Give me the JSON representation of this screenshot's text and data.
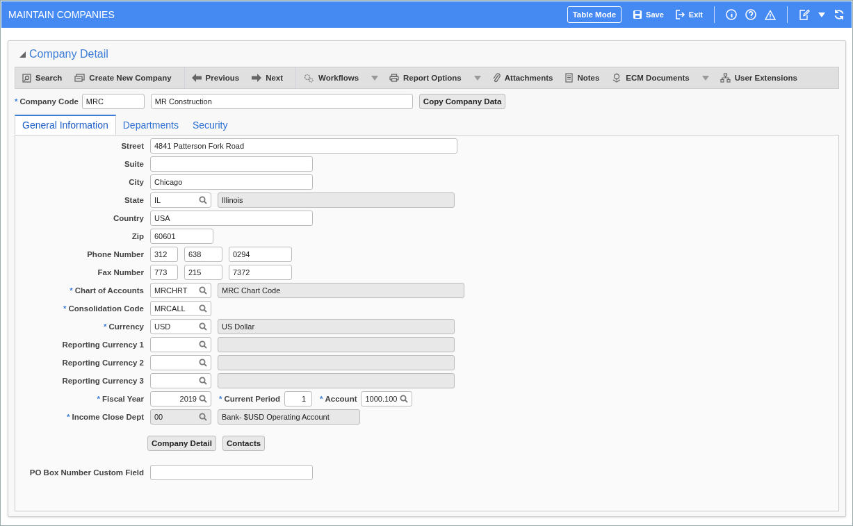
{
  "window": {
    "title": "MAINTAIN COMPANIES"
  },
  "header_actions": [
    {
      "kind": "outlined",
      "label": "Table Mode"
    },
    {
      "kind": "save",
      "label": "Save"
    },
    {
      "kind": "exit",
      "label": "Exit"
    }
  ],
  "panel": {
    "title": "Company Detail",
    "expanded": true
  },
  "toolbar": [
    {
      "label": "Search",
      "dropdown": false
    },
    {
      "label": "Create New Company",
      "dropdown": false
    },
    {
      "label": "Previous",
      "dropdown": false
    },
    {
      "label": "Next",
      "dropdown": false
    },
    {
      "label": "Workflows",
      "dropdown": true
    },
    {
      "label": "Report Options",
      "dropdown": true
    },
    {
      "label": "Attachments",
      "dropdown": false
    },
    {
      "label": "Notes",
      "dropdown": false
    },
    {
      "label": "ECM Documents",
      "dropdown": true
    },
    {
      "label": "User Extensions",
      "dropdown": false
    }
  ],
  "company": {
    "mark": "*",
    "label": "Company Code",
    "code": "MRC",
    "name": "MR Construction",
    "button": "Copy Company Data"
  },
  "tabs": [
    {
      "label": "General Information",
      "selected": true
    },
    {
      "label": "Departments",
      "selected": false
    },
    {
      "label": "Security",
      "selected": false
    }
  ],
  "form": [
    {
      "label": "Street",
      "fields": [
        {
          "kind": "text",
          "value": "4841 Patterson Fork Road",
          "disabled": false
        }
      ]
    },
    {
      "label": "Suite",
      "fields": [
        {
          "kind": "text",
          "disabled": false
        }
      ]
    },
    {
      "label": "City",
      "fields": [
        {
          "kind": "text",
          "value": "Chicago",
          "disabled": false
        }
      ]
    },
    {
      "label": "State",
      "fields": [
        {
          "kind": "lookup",
          "value": "IL",
          "disabled": false
        },
        {
          "kind": "display",
          "value": "Illinois",
          "disabled": true
        }
      ]
    },
    {
      "label": "Country",
      "fields": [
        {
          "kind": "text",
          "value": "USA",
          "disabled": false
        }
      ]
    },
    {
      "label": "Zip",
      "fields": [
        {
          "kind": "text",
          "value": "60601",
          "disabled": false
        }
      ]
    },
    {
      "label": "Phone Number",
      "fields": [
        {
          "kind": "text",
          "value": "312",
          "disabled": false
        },
        {
          "kind": "text",
          "value": "638",
          "disabled": false
        },
        {
          "kind": "text",
          "value": "0294",
          "disabled": false
        }
      ]
    },
    {
      "label": "Fax Number",
      "fields": [
        {
          "kind": "text",
          "value": "773",
          "disabled": false
        },
        {
          "kind": "text",
          "value": "215",
          "disabled": false
        },
        {
          "kind": "text",
          "value": "7372",
          "disabled": false
        }
      ]
    },
    {
      "mark": "*",
      "label": "Chart of Accounts",
      "fields": [
        {
          "kind": "lookup",
          "value": "MRCHRT",
          "disabled": false
        },
        {
          "kind": "display",
          "value": "MRC Chart Code",
          "disabled": true
        }
      ]
    },
    {
      "mark": "*",
      "label": "Consolidation Code",
      "fields": [
        {
          "kind": "lookup",
          "value": "MRCALL",
          "disabled": false
        }
      ]
    },
    {
      "mark": "*",
      "label": "Currency",
      "fields": [
        {
          "kind": "lookup",
          "value": "USD",
          "disabled": false
        },
        {
          "kind": "display",
          "value": "US Dollar",
          "disabled": true
        }
      ]
    },
    {
      "label": "Reporting Currency 1",
      "fields": [
        {
          "kind": "lookup",
          "disabled": false
        },
        {
          "kind": "display",
          "disabled": true
        }
      ]
    },
    {
      "label": "Reporting Currency 2",
      "fields": [
        {
          "kind": "lookup",
          "disabled": false
        },
        {
          "kind": "display",
          "disabled": true
        }
      ]
    },
    {
      "label": "Reporting Currency 3",
      "fields": [
        {
          "kind": "lookup",
          "disabled": false
        },
        {
          "kind": "display",
          "disabled": true
        }
      ]
    },
    {
      "mark": "*",
      "label": "Fiscal Year",
      "fields": [
        {
          "kind": "lookup",
          "value": "2019",
          "disabled": false
        },
        {
          "kind": "label",
          "mark": "*",
          "value": "Current Period"
        },
        {
          "kind": "text",
          "value": "1",
          "disabled": false
        },
        {
          "kind": "label",
          "mark": "*",
          "value": "Account"
        },
        {
          "kind": "lookup",
          "value": "1000.100",
          "disabled": false
        }
      ]
    },
    {
      "mark": "*",
      "label": "Income Close Dept",
      "fields": [
        {
          "kind": "lookup",
          "value": "00",
          "disabled": true
        },
        {
          "kind": "display",
          "value": "Bank- $USD Operating Account",
          "disabled": true
        }
      ]
    }
  ],
  "buttons": [
    "Company Detail",
    "Contacts"
  ],
  "custom": {
    "label": "PO Box Number Custom Field"
  }
}
